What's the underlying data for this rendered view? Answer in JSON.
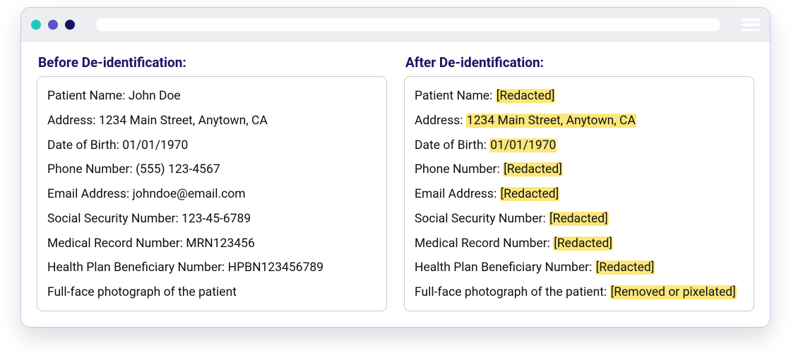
{
  "window": {
    "dots": [
      "teal",
      "indigo",
      "navy"
    ]
  },
  "before": {
    "title": "Before De-identification:",
    "rows": [
      {
        "label": "Patient Name",
        "sep": ": ",
        "value": "John Doe",
        "highlight": false
      },
      {
        "label": "Address",
        "sep": ": ",
        "value": "1234 Main Street, Anytown, CA",
        "highlight": false
      },
      {
        "label": "Date of Birth",
        "sep": ": ",
        "value": "01/01/1970",
        "highlight": false
      },
      {
        "label": "Phone Number",
        "sep": ": ",
        "value": "(555) 123-4567",
        "highlight": false
      },
      {
        "label": "Email Address",
        "sep": ": ",
        "value": "johndoe@email.com",
        "highlight": false
      },
      {
        "label": "Social Security Number",
        "sep": ": ",
        "value": "123-45-6789",
        "highlight": false
      },
      {
        "label": "Medical Record Number",
        "sep": ": ",
        "value": "MRN123456",
        "highlight": false
      },
      {
        "label": "Health Plan Beneficiary Number",
        "sep": ": ",
        "value": "HPBN123456789",
        "highlight": false
      },
      {
        "label": "Full-face photograph of the patient",
        "sep": "",
        "value": "",
        "highlight": false
      }
    ]
  },
  "after": {
    "title": "After De-identification:",
    "rows": [
      {
        "label": "Patient Name",
        "sep": ": ",
        "value": "[Redacted]",
        "highlight": true
      },
      {
        "label": "Address",
        "sep": ": ",
        "value": "1234 Main Street, Anytown, CA",
        "highlight": true
      },
      {
        "label": "Date of Birth",
        "sep": ": ",
        "value": "01/01/1970",
        "highlight": true
      },
      {
        "label": "Phone Number",
        "sep": ": ",
        "value": "[Redacted]",
        "highlight": true
      },
      {
        "label": "Email Address",
        "sep": ": ",
        "value": "[Redacted]",
        "highlight": true
      },
      {
        "label": "Social Security Number",
        "sep": ": ",
        "value": "[Redacted]",
        "highlight": true
      },
      {
        "label": "Medical Record Number",
        "sep": ": ",
        "value": "[Redacted]",
        "highlight": true
      },
      {
        "label": "Health Plan Beneficiary Number",
        "sep": ": ",
        "value": "[Redacted]",
        "highlight": true
      },
      {
        "label": "Full-face photograph of the patient",
        "sep": ": ",
        "value": "[Removed or pixelated]",
        "highlight": true
      }
    ]
  }
}
